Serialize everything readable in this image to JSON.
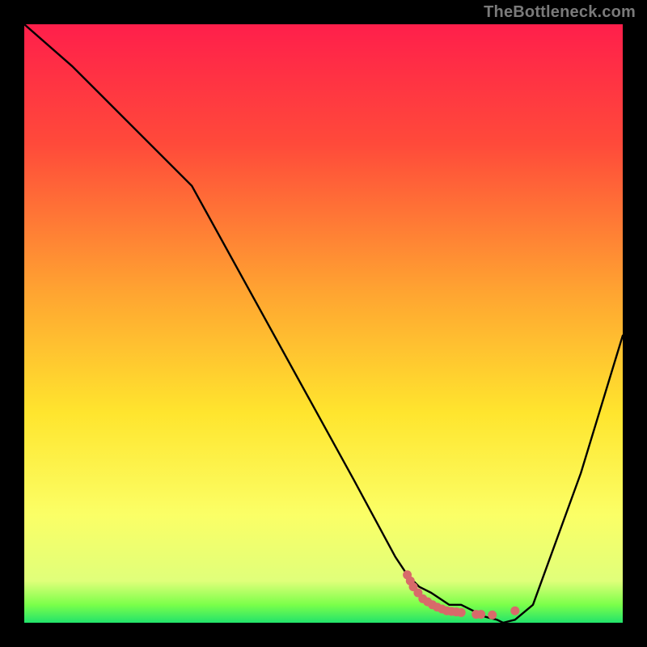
{
  "watermark": "TheBottleneck.com",
  "chart_data": {
    "type": "line",
    "title": "",
    "xlabel": "",
    "ylabel": "",
    "xlim": [
      0,
      100
    ],
    "ylim": [
      0,
      100
    ],
    "gradient_stops": [
      {
        "offset": 0.0,
        "color": "#ff1f4b"
      },
      {
        "offset": 0.2,
        "color": "#ff4a3a"
      },
      {
        "offset": 0.45,
        "color": "#ffa531"
      },
      {
        "offset": 0.65,
        "color": "#ffe52e"
      },
      {
        "offset": 0.82,
        "color": "#fbff66"
      },
      {
        "offset": 0.93,
        "color": "#e0ff7a"
      },
      {
        "offset": 0.97,
        "color": "#7bff4a"
      },
      {
        "offset": 1.0,
        "color": "#22e36b"
      }
    ],
    "series": [
      {
        "name": "bottleneck-curve",
        "x": [
          0,
          8,
          18,
          28,
          55,
          62,
          64,
          66,
          68,
          71,
          73,
          75,
          77,
          79,
          80,
          82,
          85,
          93,
          100
        ],
        "values": [
          100,
          93,
          83,
          73,
          24,
          11,
          8,
          6,
          5,
          3,
          3,
          2,
          1,
          0.5,
          0,
          0.5,
          3,
          25,
          48
        ]
      }
    ],
    "markers": [
      {
        "x": 64.0,
        "y": 8.0
      },
      {
        "x": 64.5,
        "y": 7.0
      },
      {
        "x": 65.0,
        "y": 6.0
      },
      {
        "x": 65.8,
        "y": 5.0
      },
      {
        "x": 66.6,
        "y": 4.0
      },
      {
        "x": 67.4,
        "y": 3.5
      },
      {
        "x": 68.2,
        "y": 3.0
      },
      {
        "x": 69.0,
        "y": 2.6
      },
      {
        "x": 69.8,
        "y": 2.3
      },
      {
        "x": 70.6,
        "y": 2.0
      },
      {
        "x": 71.4,
        "y": 1.9
      },
      {
        "x": 72.2,
        "y": 1.8
      },
      {
        "x": 73.0,
        "y": 1.7
      },
      {
        "x": 75.5,
        "y": 1.4
      },
      {
        "x": 76.3,
        "y": 1.4
      },
      {
        "x": 78.2,
        "y": 1.3
      },
      {
        "x": 82.0,
        "y": 2.0
      }
    ],
    "marker_color": "#d86a6a",
    "curve_color": "#000000"
  }
}
